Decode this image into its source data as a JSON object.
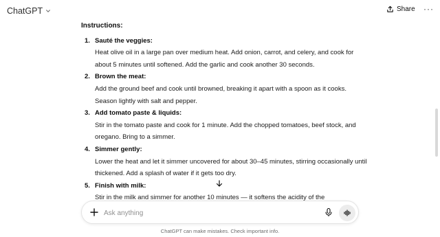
{
  "header": {
    "model_label": "ChatGPT",
    "share_label": "Share",
    "more_label": "···"
  },
  "message": {
    "section_heading": "Instructions:",
    "steps": [
      {
        "number": "1.",
        "title": "Sauté the veggies:",
        "body": "Heat olive oil in a large pan over medium heat. Add onion, carrot, and celery, and cook for about 5 minutes until softened. Add the garlic and cook another 30 seconds."
      },
      {
        "number": "2.",
        "title": "Brown the meat:",
        "body": "Add the ground beef and cook until browned, breaking it apart with a spoon as it cooks. Season lightly with salt and pepper."
      },
      {
        "number": "3.",
        "title": "Add tomato paste & liquids:",
        "body": "Stir in the tomato paste and cook for 1 minute. Add the chopped tomatoes, beef stock, and oregano. Bring to a simmer."
      },
      {
        "number": "4.",
        "title": "Simmer gently:",
        "body": "Lower the heat and let it simmer uncovered for about 30–45 minutes, stirring occasionally until thickened. Add a splash of water if it gets too dry."
      },
      {
        "number": "5.",
        "title": "Finish with milk:",
        "body": "Stir in the milk and simmer for another 10 minutes — it softens the acidity of the"
      }
    ]
  },
  "composer": {
    "placeholder": "Ask anything"
  },
  "footer": {
    "disclaimer": "ChatGPT can make mistakes. Check important info."
  },
  "icons": {
    "model_chevron": "chevron-down-icon",
    "share": "share-icon",
    "scroll_down": "arrow-down-icon",
    "plus": "plus-icon",
    "mic": "microphone-icon",
    "voice": "voice-mode-icon"
  }
}
